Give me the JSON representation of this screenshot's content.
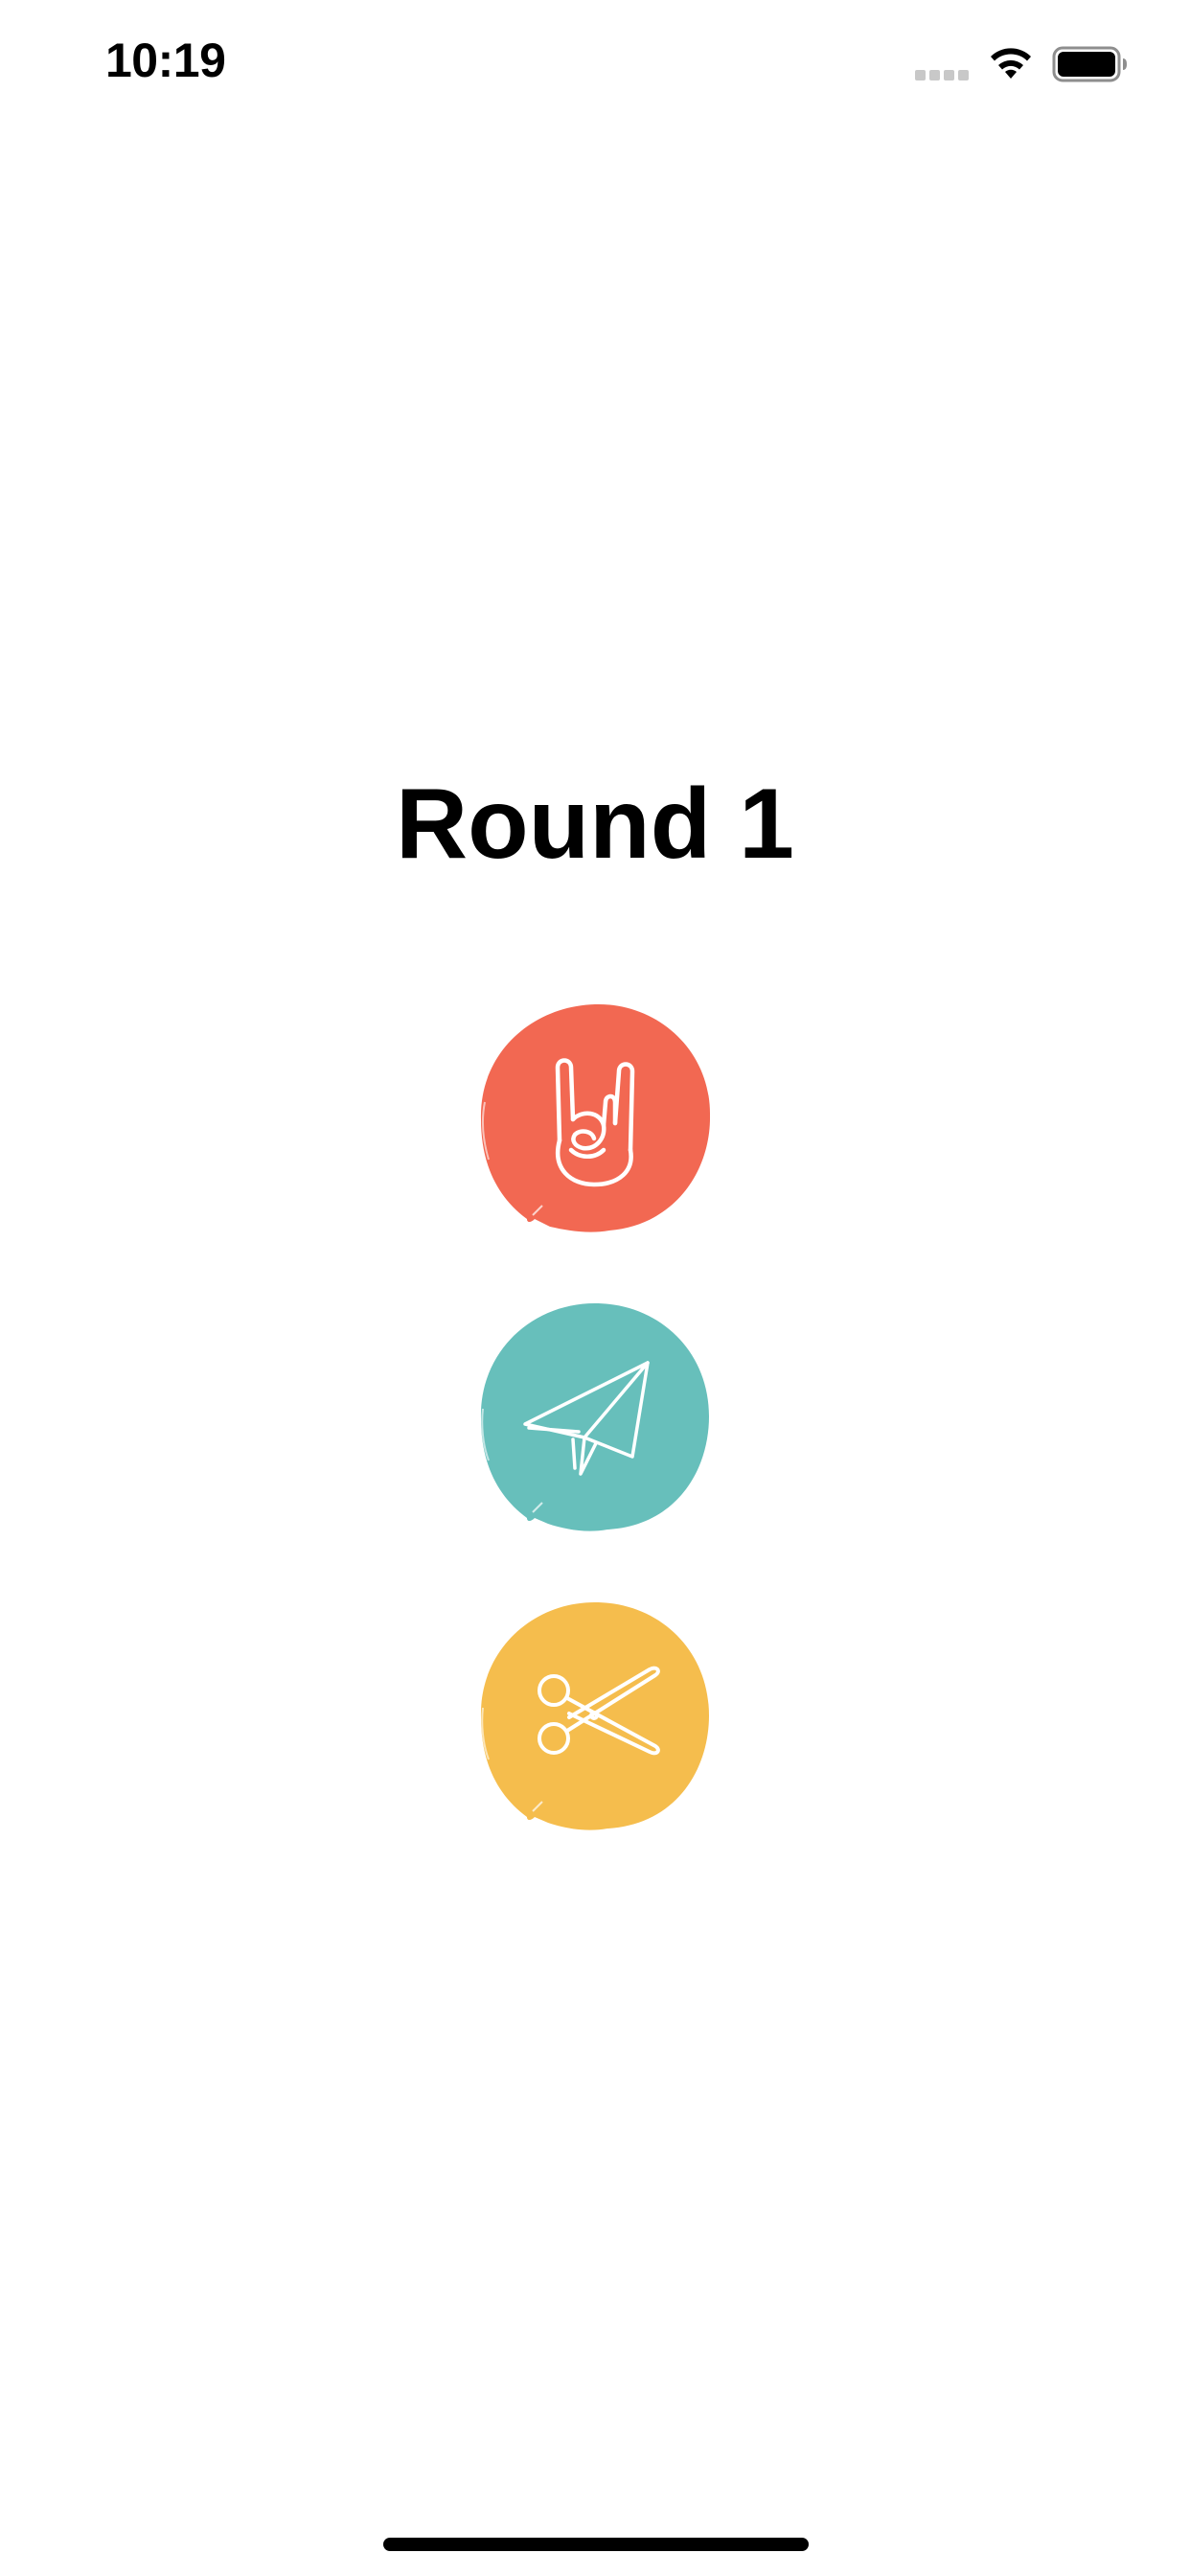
{
  "status_bar": {
    "time": "10:19"
  },
  "screen": {
    "title": "Round 1"
  },
  "choices": [
    {
      "name": "rock",
      "icon": "rock-hand-icon",
      "color": "#f26852"
    },
    {
      "name": "paper",
      "icon": "paper-plane-icon",
      "color": "#67bfbb"
    },
    {
      "name": "scissors",
      "icon": "scissors-icon",
      "color": "#f5bd4d"
    }
  ],
  "colors": {
    "background": "#ffffff",
    "text": "#000000",
    "icon_stroke": "#ffffff"
  }
}
